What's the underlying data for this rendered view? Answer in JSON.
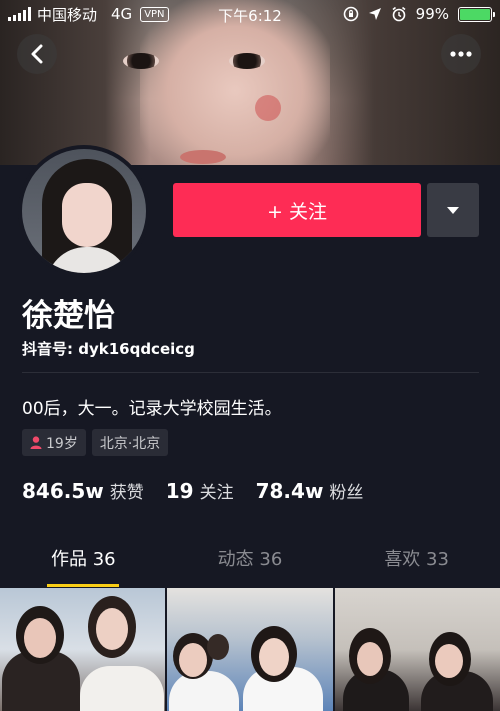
{
  "status_bar": {
    "carrier": "中国移动",
    "network": "4G",
    "vpn": "VPN",
    "time": "下午6:12",
    "battery": "99%",
    "battery_level": 0.99
  },
  "profile": {
    "name": "徐楚怡",
    "douyin_id": "抖音号: dyk16qdceicg",
    "bio": "00后，大一。记录大学校园生活。",
    "tags": {
      "age": "19岁",
      "location": "北京·北京"
    }
  },
  "actions": {
    "follow_label": "+ 关注"
  },
  "stats": [
    {
      "value": "846.5w",
      "label": "获赞"
    },
    {
      "value": "19",
      "label": "关注"
    },
    {
      "value": "78.4w",
      "label": "粉丝"
    }
  ],
  "tabs": [
    {
      "label": "作品 36"
    },
    {
      "label": "动态 36"
    },
    {
      "label": "喜欢 33"
    }
  ],
  "colors": {
    "accent": "#fe2c55",
    "tab_indicator": "#face15",
    "background": "#161823"
  },
  "icons": {
    "back": "chevron-left-icon",
    "more": "more-dots-icon",
    "dropdown": "caret-down-icon",
    "gender": "person-icon"
  }
}
